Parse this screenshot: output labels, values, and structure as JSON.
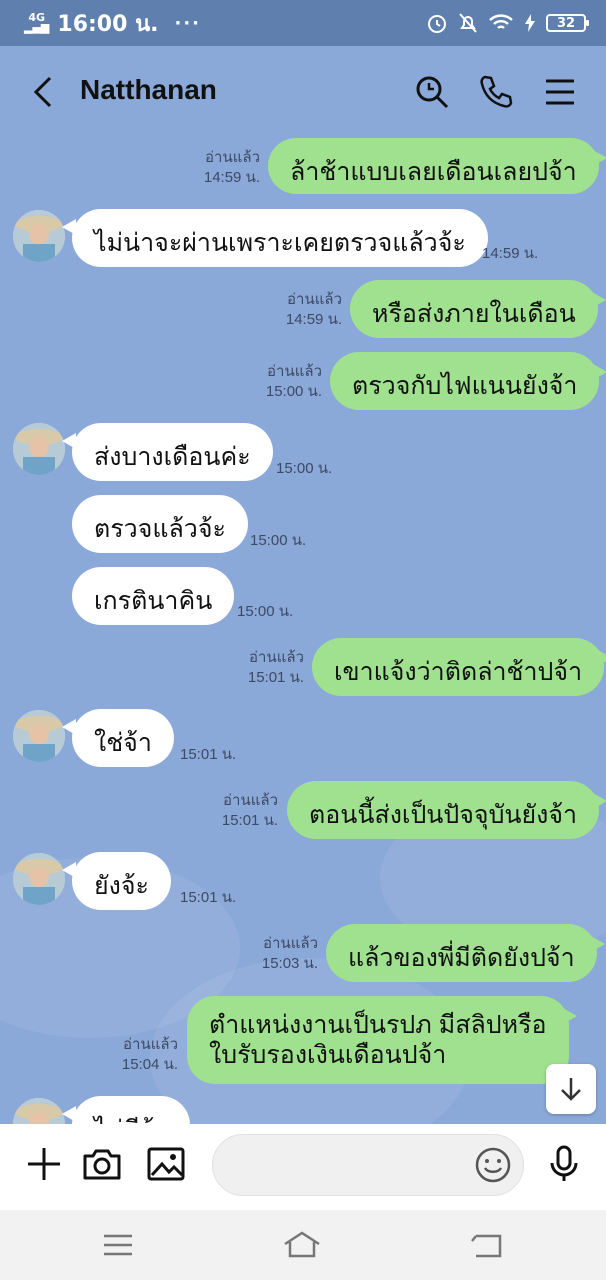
{
  "status": {
    "network": "4G",
    "time": "16:00 น.",
    "dots": "···",
    "battery": "32"
  },
  "header": {
    "contact_name": "Natthanan"
  },
  "messages": [
    {
      "dir": "out",
      "text": "ล้าช้าแบบเลยเดือนเลยปจ้า",
      "read": "อ่านแล้ว",
      "time": "14:59 น."
    },
    {
      "dir": "in",
      "text": "ไม่น่าจะผ่านเพราะเคยตรวจแล้วจ้ะ",
      "time": "14:59 น."
    },
    {
      "dir": "out",
      "text": "หรือส่งภายในเดือน",
      "read": "อ่านแล้ว",
      "time": "14:59 น."
    },
    {
      "dir": "out",
      "text": "ตรวจกับไฟแนนยังจ้า",
      "read": "อ่านแล้ว",
      "time": "15:00 น."
    },
    {
      "dir": "in",
      "text": "ส่งบางเดือนค่ะ",
      "time": "15:00 น."
    },
    {
      "dir": "in",
      "text": "ตรวจแล้วจ้ะ",
      "time": "15:00 น."
    },
    {
      "dir": "in",
      "text": "เกรตินาคิน",
      "time": "15:00 น."
    },
    {
      "dir": "out",
      "text": "เขาแจ้งว่าติดล่าช้าปจ้า",
      "read": "อ่านแล้ว",
      "time": "15:01 น."
    },
    {
      "dir": "in",
      "text": "ใช่จ้า",
      "time": "15:01 น."
    },
    {
      "dir": "out",
      "text": "ตอนนี้ส่งเป็นปัจจุบันยังจ้า",
      "read": "อ่านแล้ว",
      "time": "15:01 น."
    },
    {
      "dir": "in",
      "text": "ยังจ้ะ",
      "time": "15:01 น."
    },
    {
      "dir": "out",
      "text": "แล้วของพี่มีติดยังปจ้า",
      "read": "อ่านแล้ว",
      "time": "15:03 น."
    },
    {
      "dir": "out",
      "text": "ตำแหน่งงานเป็นรปภ มีสลิปหรือ",
      "text2": "ใบรับรองเงินเดือนปจ้า",
      "read": "อ่านแล้ว",
      "time": "15:04 น."
    },
    {
      "dir": "in",
      "text": "ไม่มีจ้ะ"
    }
  ],
  "input": {
    "placeholder": ""
  },
  "icons": {
    "back": "chevron-left-icon",
    "search": "search-icon",
    "call": "phone-icon",
    "menu": "hamburger-menu-icon",
    "plus": "plus-icon",
    "camera": "camera-icon",
    "image": "image-icon",
    "emoji": "emoji-icon",
    "mic": "microphone-icon",
    "scroll": "arrow-down-icon",
    "nav_menu": "nav-menu-icon",
    "nav_home": "nav-home-icon",
    "nav_back": "nav-back-icon"
  },
  "colors": {
    "background": "#8aa8d8",
    "status_bar": "#5f7fae",
    "outgoing": "#9fe18f",
    "incoming": "#ffffff"
  }
}
